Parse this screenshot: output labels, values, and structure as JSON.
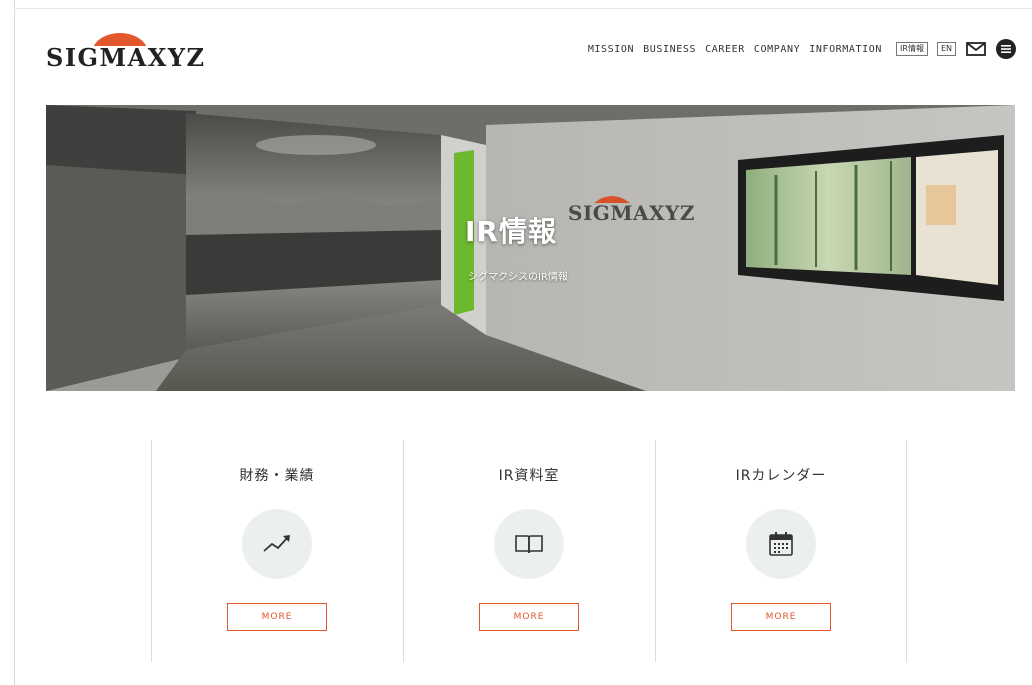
{
  "header": {
    "logo_text": "SIGMAXYZ",
    "nav": [
      "MISSION",
      "BUSINESS",
      "CAREER",
      "COMPANY",
      "INFORMATION"
    ],
    "ir_link": "IR情報",
    "en_link": "EN",
    "mail_icon": "mail-icon",
    "menu_icon": "menu-icon"
  },
  "hero": {
    "title": "IR情報",
    "subtitle": "シグマクシスのIR情報",
    "sign_text": "SIGMAXYZ"
  },
  "cards": [
    {
      "title": "財務・業績",
      "icon": "trend-chart-icon",
      "button": "MORE"
    },
    {
      "title": "IR資料室",
      "icon": "book-icon",
      "button": "MORE"
    },
    {
      "title": "IRカレンダー",
      "icon": "calendar-icon",
      "button": "MORE"
    }
  ],
  "colors": {
    "accent": "#e2572b",
    "icon_bg": "#eceff0"
  }
}
